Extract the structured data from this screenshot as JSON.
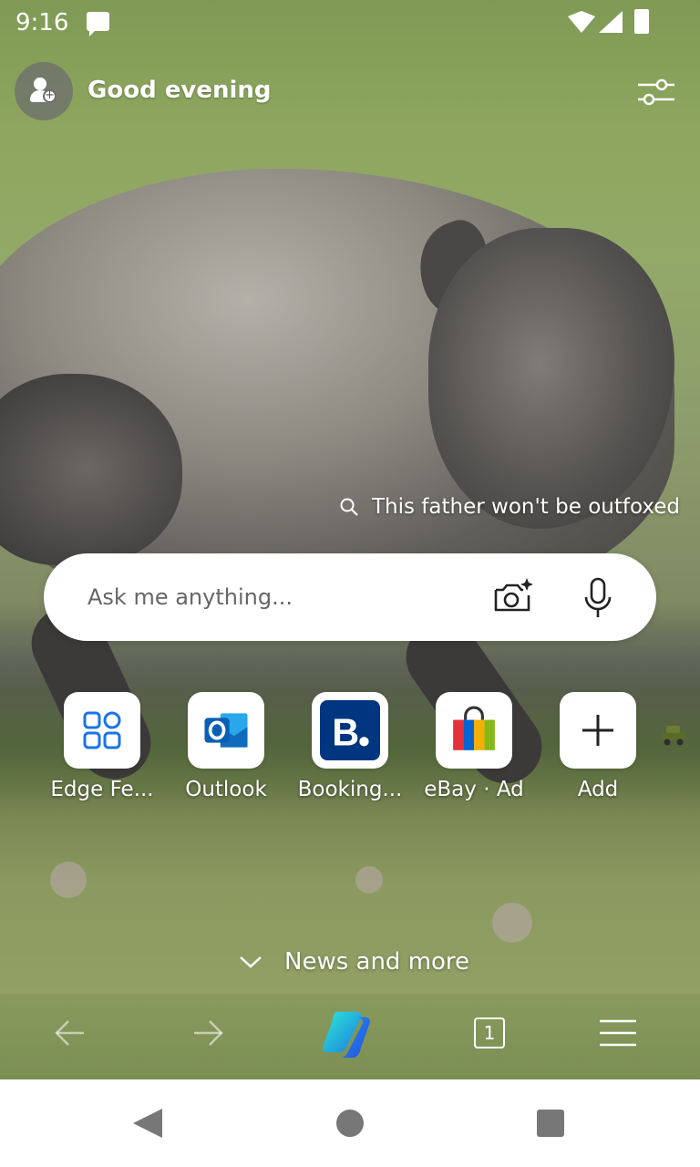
{
  "status_bar": {
    "time": "9:16",
    "icons": [
      "message-icon",
      "wifi-icon",
      "signal-icon",
      "battery-icon"
    ]
  },
  "header": {
    "greeting": "Good evening",
    "avatar_icon": "add-profile-icon",
    "settings_icon": "page-settings-icon"
  },
  "background": {
    "caption": "This father won't be outfoxed"
  },
  "search": {
    "placeholder": "Ask me anything...",
    "camera_icon": "visual-search-icon",
    "mic_icon": "microphone-icon"
  },
  "quick_links": [
    {
      "label": "Edge Fe...",
      "icon": "edge-features-icon"
    },
    {
      "label": "Outlook",
      "icon": "outlook-icon"
    },
    {
      "label": "Booking...",
      "icon": "booking-icon"
    },
    {
      "label": "eBay · Ad",
      "icon": "ebay-bag-icon"
    },
    {
      "label": "Add",
      "icon": "plus-icon"
    }
  ],
  "news": {
    "label": "News and more"
  },
  "toolbar": {
    "tab_count": "1",
    "icons": [
      "back-arrow-icon",
      "forward-arrow-icon",
      "copilot-icon",
      "tabs-icon",
      "menu-icon"
    ]
  },
  "colors": {
    "outlook_blue": "#0f6cbd",
    "booking_blue": "#003580",
    "edge_blue": "#1a73e8"
  }
}
